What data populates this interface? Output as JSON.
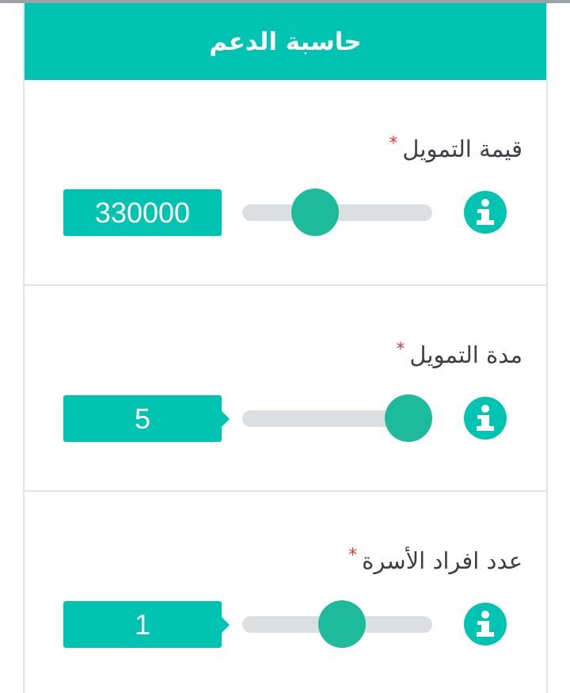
{
  "header": {
    "title": "حاسبة الدعم"
  },
  "colors": {
    "accent": "#00c4b1",
    "thumb": "#1dbb9b",
    "track": "#dcdfe1",
    "required": "#d23c3c"
  },
  "fields": [
    {
      "label": "قيمة التمويل",
      "required_mark": "*",
      "value": "330000",
      "slider_fraction": 0.44,
      "icon": "info-icon"
    },
    {
      "label": "مدة التمويل",
      "required_mark": "*",
      "value": "5",
      "slider_fraction": 1.0,
      "icon": "info-icon"
    },
    {
      "label": "عدد افراد الأسرة",
      "required_mark": "*",
      "value": "1",
      "slider_fraction": 0.6,
      "icon": "info-icon"
    }
  ]
}
